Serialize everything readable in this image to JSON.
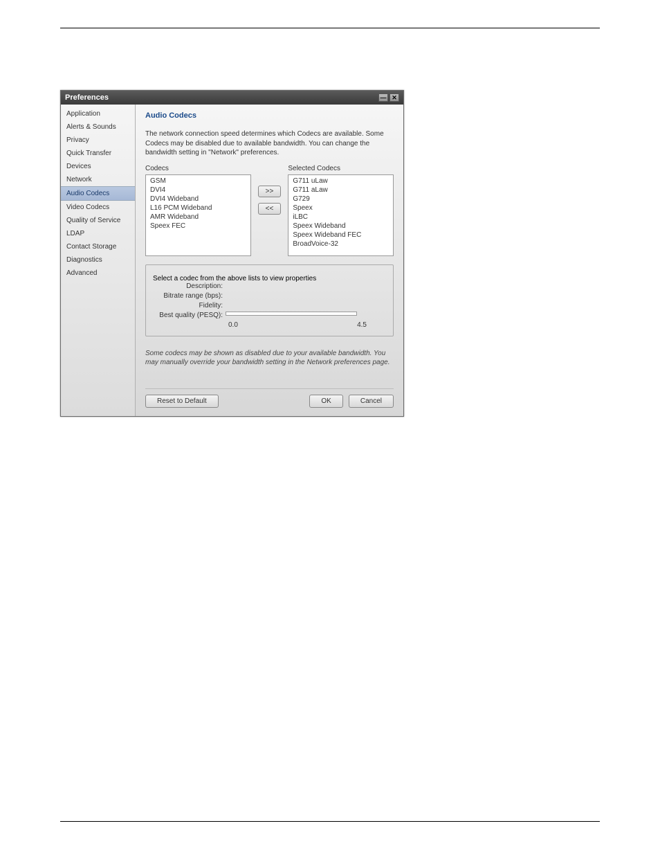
{
  "window": {
    "title": "Preferences"
  },
  "sidebar": {
    "items": [
      {
        "label": "Application",
        "selected": false
      },
      {
        "label": "Alerts & Sounds",
        "selected": false
      },
      {
        "label": "Privacy",
        "selected": false
      },
      {
        "label": "Quick Transfer",
        "selected": false
      },
      {
        "label": "Devices",
        "selected": false
      },
      {
        "label": "Network",
        "selected": false
      },
      {
        "label": "Audio Codecs",
        "selected": true
      },
      {
        "label": "Video Codecs",
        "selected": false
      },
      {
        "label": "Quality of Service",
        "selected": false
      },
      {
        "label": "LDAP",
        "selected": false
      },
      {
        "label": "Contact Storage",
        "selected": false
      },
      {
        "label": "Diagnostics",
        "selected": false
      },
      {
        "label": "Advanced",
        "selected": false
      }
    ]
  },
  "panel": {
    "heading": "Audio Codecs",
    "description": "The network connection speed determines which Codecs are available. Some Codecs may be disabled due to available bandwidth. You can change the bandwidth setting in \"Network\" preferences.",
    "codecs_label": "Codecs",
    "selected_label": "Selected Codecs",
    "codecs": [
      "GSM",
      "DVI4",
      "DVI4 Wideband",
      "L16 PCM Wideband",
      "AMR Wideband",
      "Speex FEC"
    ],
    "selected_codecs": [
      "G711 uLaw",
      "G711 aLaw",
      "G729",
      "Speex",
      "iLBC",
      "Speex Wideband",
      "Speex Wideband FEC",
      "BroadVoice-32"
    ],
    "add_label": ">>",
    "remove_label": "<<",
    "props": {
      "legend": "Select a codec from the above lists to view properties",
      "description_label": "Description:",
      "bitrate_label": "Bitrate range (bps):",
      "fidelity_label": "Fidelity:",
      "pesq_label": "Best quality (PESQ):",
      "scale_min": "0.0",
      "scale_max": "4.5"
    },
    "note": "Some codecs may be shown as disabled due to your available bandwidth. You may manually override your bandwidth setting in the Network preferences page.",
    "reset_label": "Reset to Default",
    "ok_label": "OK",
    "cancel_label": "Cancel"
  }
}
